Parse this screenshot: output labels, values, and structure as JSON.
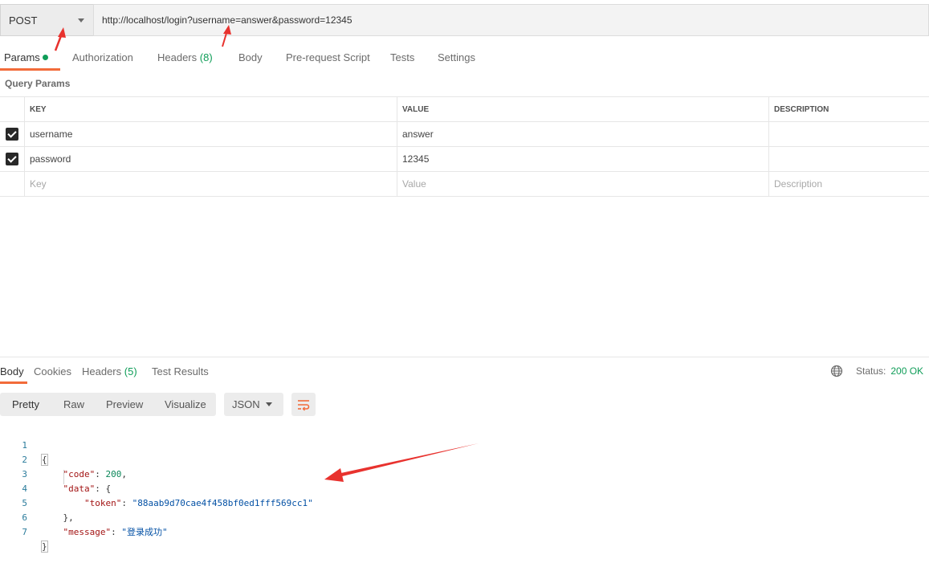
{
  "request": {
    "method": "POST",
    "url": "http://localhost/login?username=answer&password=12345"
  },
  "request_tabs": [
    {
      "label": "Params"
    },
    {
      "label": "Authorization"
    },
    {
      "label": "Headers",
      "count": "(8)"
    },
    {
      "label": "Body"
    },
    {
      "label": "Pre-request Script"
    },
    {
      "label": "Tests"
    },
    {
      "label": "Settings"
    }
  ],
  "query_params": {
    "title": "Query Params",
    "columns": {
      "key": "KEY",
      "value": "VALUE",
      "description": "DESCRIPTION"
    },
    "rows": [
      {
        "checked": true,
        "key": "username",
        "value": "answer",
        "description": ""
      },
      {
        "checked": true,
        "key": "password",
        "value": "12345",
        "description": ""
      }
    ],
    "placeholders": {
      "key": "Key",
      "value": "Value",
      "description": "Description"
    }
  },
  "response_tabs": [
    {
      "label": "Body"
    },
    {
      "label": "Cookies"
    },
    {
      "label": "Headers",
      "count": "(5)"
    },
    {
      "label": "Test Results"
    }
  ],
  "status": {
    "label": "Status:",
    "value": "200 OK"
  },
  "format_tabs": [
    "Pretty",
    "Raw",
    "Preview",
    "Visualize"
  ],
  "format_select": "JSON",
  "code": {
    "line_numbers": [
      "1",
      "2",
      "3",
      "4",
      "5",
      "6",
      "7"
    ],
    "open_brace": "{",
    "close_brace": "}",
    "code_key": "\"code\"",
    "code_value": "200",
    "data_key": "\"data\"",
    "data_open": "{",
    "token_key": "\"token\"",
    "token_value": "\"88aab9d70cae4f458bf0ed1fff569cc1\"",
    "data_close": "},",
    "message_key": "\"message\"",
    "message_value": "\"登录成功\""
  },
  "colors": {
    "accent": "#f26b3a",
    "success": "#0f9d58",
    "annotation_arrow": "#e8322e"
  }
}
